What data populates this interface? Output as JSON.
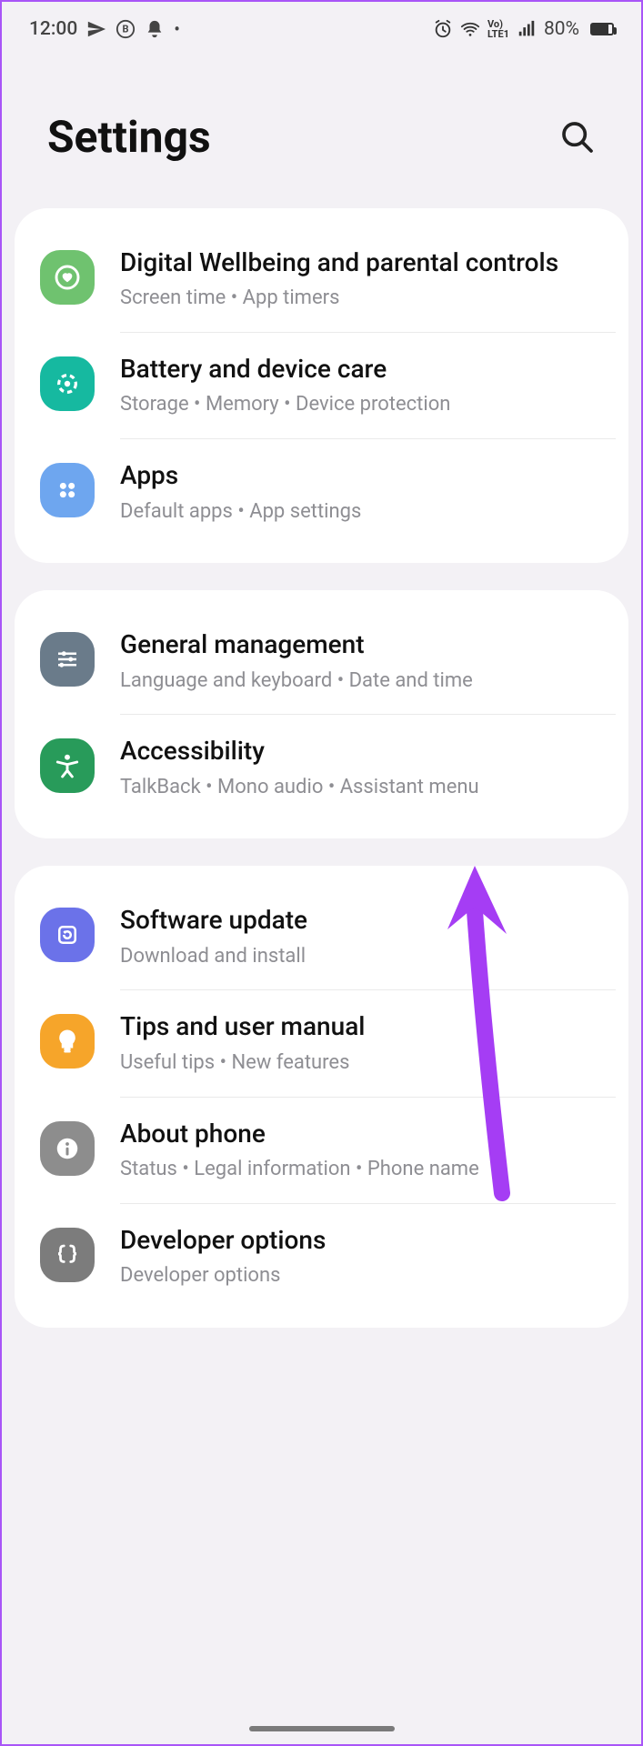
{
  "status": {
    "time": "12:00",
    "battery": "80%",
    "icons_left": [
      "send",
      "circle-b",
      "bell",
      "dot"
    ],
    "icons_right": [
      "alarm",
      "wifi",
      "volte",
      "signal"
    ]
  },
  "header": {
    "title": "Settings"
  },
  "groups": [
    {
      "items": [
        {
          "key": "digital-wellbeing",
          "title": "Digital Wellbeing and parental controls",
          "sub": "Screen time  •  App timers",
          "icon_color": "#6fc26f"
        },
        {
          "key": "battery-care",
          "title": "Battery and device care",
          "sub": "Storage  •  Memory  •  Device protection",
          "icon_color": "#16b9a0"
        },
        {
          "key": "apps",
          "title": "Apps",
          "sub": "Default apps  •  App settings",
          "icon_color": "#6ea6ef"
        }
      ]
    },
    {
      "items": [
        {
          "key": "general-management",
          "title": "General management",
          "sub": "Language and keyboard  •  Date and time",
          "icon_color": "#6a7b8a"
        },
        {
          "key": "accessibility",
          "title": "Accessibility",
          "sub": "TalkBack  •  Mono audio  •  Assistant menu",
          "icon_color": "#289b5a"
        }
      ]
    },
    {
      "items": [
        {
          "key": "software-update",
          "title": "Software update",
          "sub": "Download and install",
          "icon_color": "#6b72e9"
        },
        {
          "key": "tips-manual",
          "title": "Tips and user manual",
          "sub": "Useful tips  •  New features",
          "icon_color": "#f6a52a"
        },
        {
          "key": "about-phone",
          "title": "About phone",
          "sub": "Status  •  Legal information  •  Phone name",
          "icon_color": "#8d8d8d"
        },
        {
          "key": "developer-options",
          "title": "Developer options",
          "sub": "Developer options",
          "icon_color": "#7c7c7c"
        }
      ]
    }
  ],
  "annotation": {
    "color": "#a53df4"
  }
}
